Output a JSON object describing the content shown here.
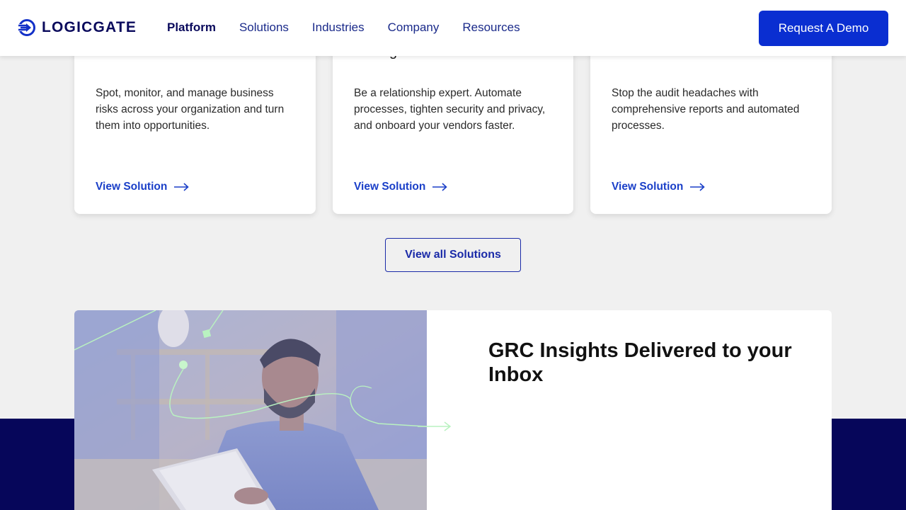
{
  "header": {
    "logo_text": "LOGICGATE",
    "nav": [
      {
        "label": "Platform",
        "active": true
      },
      {
        "label": "Solutions"
      },
      {
        "label": "Industries"
      },
      {
        "label": "Company"
      },
      {
        "label": "Resources"
      }
    ],
    "demo_button": "Request A Demo"
  },
  "solutions": {
    "cards": [
      {
        "title": "",
        "description": "Spot, monitor, and manage business risks across your organization and turn them into opportunities.",
        "link": "View Solution"
      },
      {
        "title": "Management",
        "description": "Be a relationship expert. Automate processes, tighten security and privacy, and onboard your vendors faster.",
        "link": "View Solution"
      },
      {
        "title": "",
        "description": "Stop the audit headaches with comprehensive reports and automated processes.",
        "link": "View Solution"
      }
    ],
    "view_all": "View all Solutions"
  },
  "newsletter": {
    "title": "GRC Insights Delivered to your Inbox"
  },
  "colors": {
    "brand_navy": "#06065a",
    "accent_blue": "#0a2ed1",
    "page_bg": "#f0f0f0"
  }
}
